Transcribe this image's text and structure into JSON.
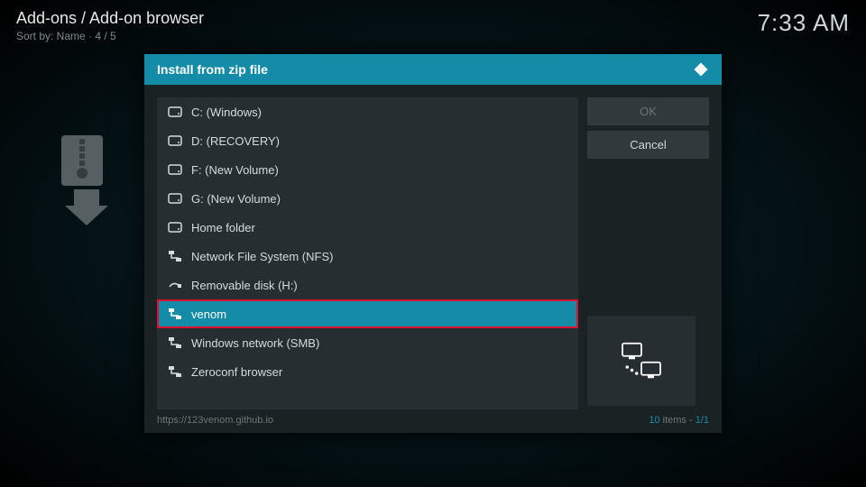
{
  "header": {
    "breadcrumb": "Add-ons / Add-on browser",
    "sort_line": "Sort by: Name  · 4 / 5",
    "clock": "7:33 AM"
  },
  "dialog": {
    "title": "Install from zip file",
    "buttons": {
      "ok": "OK",
      "cancel": "Cancel"
    },
    "items": [
      {
        "label": "C: (Windows)",
        "icon": "drive",
        "selected": false,
        "highlighted": false
      },
      {
        "label": "D: (RECOVERY)",
        "icon": "drive",
        "selected": false,
        "highlighted": false
      },
      {
        "label": "F: (New Volume)",
        "icon": "drive",
        "selected": false,
        "highlighted": false
      },
      {
        "label": "G: (New Volume)",
        "icon": "drive",
        "selected": false,
        "highlighted": false
      },
      {
        "label": "Home folder",
        "icon": "drive",
        "selected": false,
        "highlighted": false
      },
      {
        "label": "Network File System (NFS)",
        "icon": "network",
        "selected": false,
        "highlighted": false
      },
      {
        "label": "Removable disk (H:)",
        "icon": "usb",
        "selected": false,
        "highlighted": false
      },
      {
        "label": "venom",
        "icon": "network",
        "selected": true,
        "highlighted": true
      },
      {
        "label": "Windows network (SMB)",
        "icon": "network",
        "selected": false,
        "highlighted": false
      },
      {
        "label": "Zeroconf browser",
        "icon": "network",
        "selected": false,
        "highlighted": false
      }
    ],
    "footer": {
      "path": "https://123venom.github.io",
      "count_num": "10",
      "count_word": " items - ",
      "page": "1/1"
    }
  }
}
